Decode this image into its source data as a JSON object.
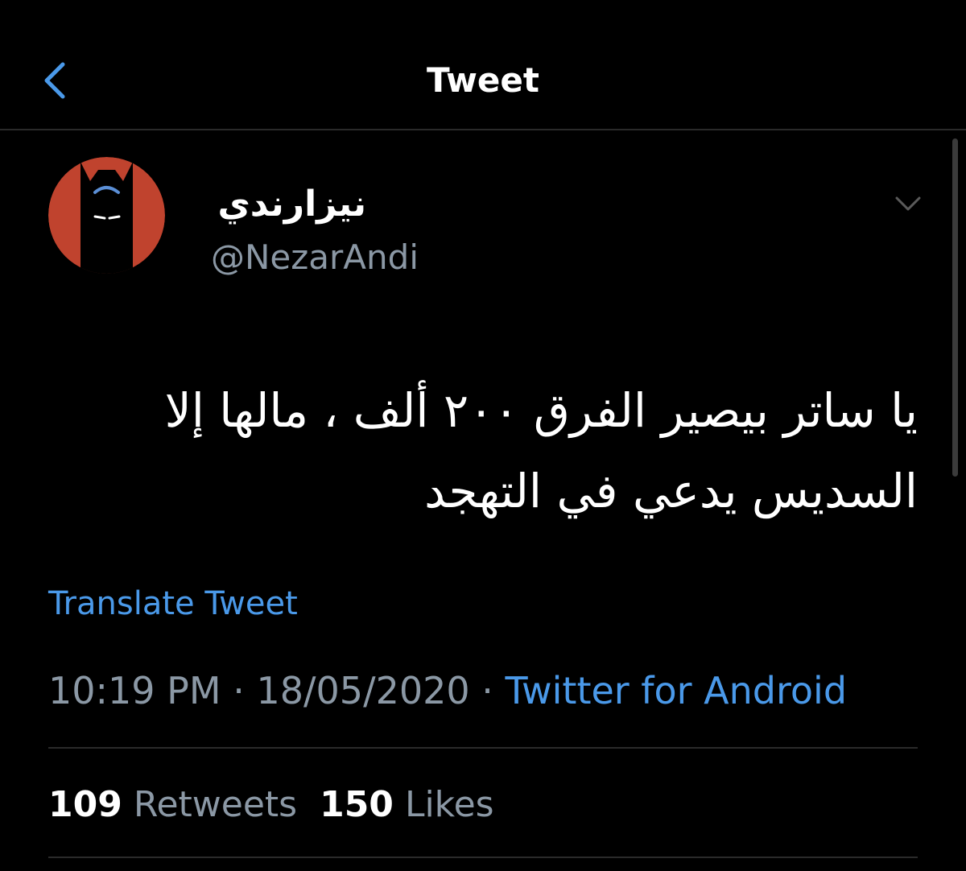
{
  "header": {
    "title": "Tweet",
    "back_icon": "chevron-left-icon"
  },
  "tweet": {
    "author": {
      "display_name": "نيزارندي",
      "handle": "@NezarAndi",
      "avatar": "batman-avatar"
    },
    "text_line_1": "يا ساتر بيصير الفرق ٢٠٠ ألف ، مالها إلا",
    "text_line_2": "السديس يدعي في التهجد",
    "translate_label": "Translate Tweet",
    "time": "10:19 PM",
    "separator": " · ",
    "date": "18/05/2020",
    "source": "Twitter for Android",
    "retweets_count": "109",
    "retweets_label": "Retweets",
    "likes_count": "150",
    "likes_label": "Likes"
  },
  "colors": {
    "background": "#000000",
    "accent": "#4a99e9",
    "muted": "#8b98a5",
    "avatar_red": "#c0432e",
    "divider": "#2a2a2a"
  }
}
